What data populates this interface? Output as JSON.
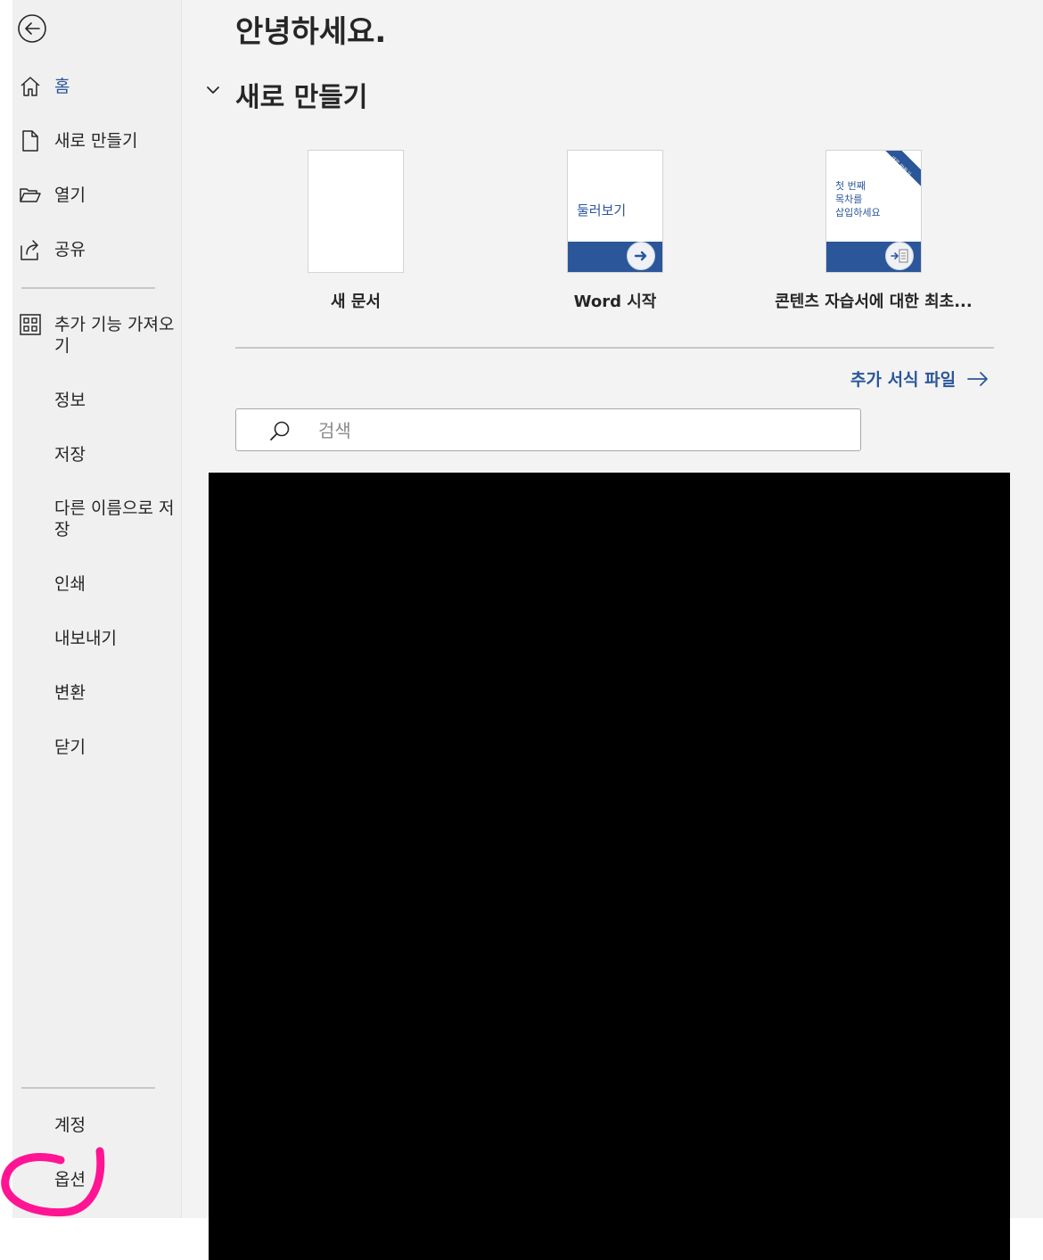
{
  "sidebar": {
    "back_icon": "back-arrow-circle-icon",
    "items": [
      {
        "id": "home",
        "label": "홈",
        "icon": "home-icon",
        "active": true
      },
      {
        "id": "new",
        "label": "새로 만들기",
        "icon": "new-document-icon"
      },
      {
        "id": "open",
        "label": "열기",
        "icon": "folder-open-icon"
      },
      {
        "id": "share",
        "label": "공유",
        "icon": "share-icon"
      },
      {
        "id": "addins",
        "label": "추가 기능 가져오기",
        "icon": "add-ins-grid-icon"
      },
      {
        "id": "info",
        "label": "정보"
      },
      {
        "id": "save",
        "label": "저장"
      },
      {
        "id": "saveas",
        "label": "다른 이름으로 저장"
      },
      {
        "id": "print",
        "label": "인쇄"
      },
      {
        "id": "export",
        "label": "내보내기"
      },
      {
        "id": "transform",
        "label": "변환"
      },
      {
        "id": "close",
        "label": "닫기"
      },
      {
        "id": "account",
        "label": "계정"
      },
      {
        "id": "options",
        "label": "옵션"
      }
    ]
  },
  "main": {
    "greeting": "안녕하세요.",
    "new_section_title": "새로 만들기",
    "templates": [
      {
        "caption": "새 문서"
      },
      {
        "caption": "Word 시작",
        "thumb_text": "둘러보기"
      },
      {
        "caption": "콘텐츠 자습서에 대한 최초...",
        "thumb_text": "첫 번째\n목차를\n삽입하세요",
        "ribbon_text": "새로 만들기"
      }
    ],
    "more_templates": "추가 서식 파일",
    "search_placeholder": "검색"
  },
  "colors": {
    "accent": "#2b579a",
    "sidebar_bg": "#f0f0f0",
    "main_bg": "#f3f3f3",
    "annotation": "#ff1493",
    "redaction": "#000000"
  }
}
